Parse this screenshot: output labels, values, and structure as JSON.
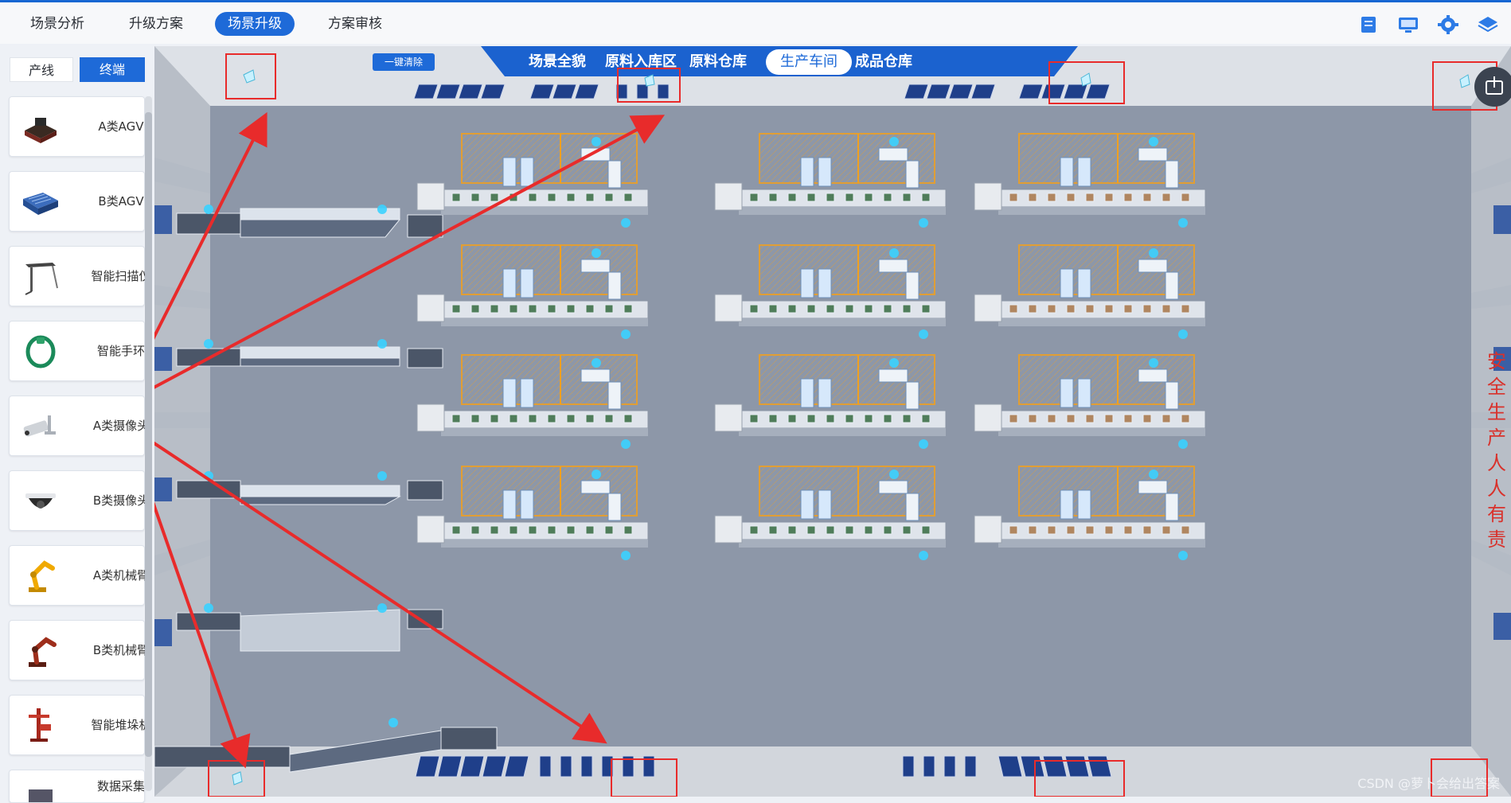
{
  "top_nav": {
    "tabs": [
      {
        "label": "场景分析"
      },
      {
        "label": "升级方案"
      },
      {
        "label": "场景升级"
      },
      {
        "label": "方案审核"
      }
    ],
    "active": "场景升级"
  },
  "toolbar_icons": [
    "document-icon",
    "monitor-icon",
    "gear-icon",
    "layers-icon"
  ],
  "left_panel": {
    "mode_tabs": [
      {
        "label": "产线"
      },
      {
        "label": "终端"
      }
    ],
    "active_mode": "终端",
    "items": [
      {
        "label": "A类AGV",
        "icon": "agv-a-icon"
      },
      {
        "label": "B类AGV",
        "icon": "agv-b-icon"
      },
      {
        "label": "智能扫描仪",
        "icon": "scanner-icon"
      },
      {
        "label": "智能手环",
        "icon": "wristband-icon"
      },
      {
        "label": "A类摄像头",
        "icon": "camera-a-icon"
      },
      {
        "label": "B类摄像头",
        "icon": "camera-b-icon"
      },
      {
        "label": "A类机械臂",
        "icon": "robot-arm-a-icon"
      },
      {
        "label": "B类机械臂",
        "icon": "robot-arm-b-icon"
      },
      {
        "label": "智能堆垛机",
        "icon": "stacker-icon"
      },
      {
        "label": "数据采集",
        "icon": "data-collector-icon"
      }
    ]
  },
  "scene": {
    "clear_button": "一键清除",
    "tabs": [
      {
        "label": "场景全貌"
      },
      {
        "label": "原料入库区"
      },
      {
        "label": "原料仓库"
      },
      {
        "label": "生产车间"
      },
      {
        "label": "成品仓库"
      }
    ],
    "active_tab": "生产车间",
    "slogan": "安全生产 人人有责",
    "watermark": "CSDN @萝卜会给出答案",
    "colors": {
      "accent": "#1e6ad8",
      "floor": "#8d97a8",
      "highlight": "#e82b2b",
      "device": "#3ad1ff",
      "cage": "#f0a020"
    }
  }
}
